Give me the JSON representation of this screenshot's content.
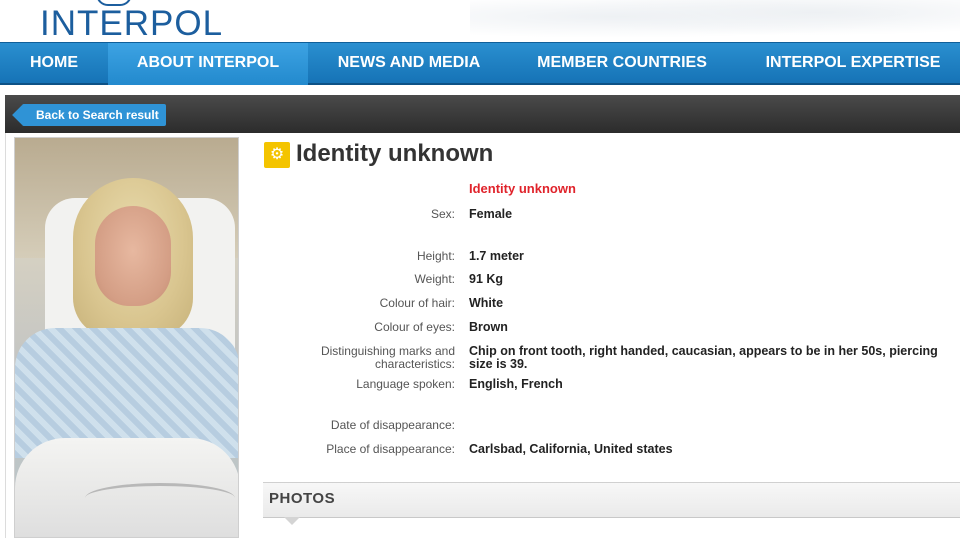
{
  "brand": {
    "logo_text": "INTERPOL",
    "color": "#1c5e9e"
  },
  "nav": {
    "items": [
      {
        "label": "HOME"
      },
      {
        "label": "ABOUT INTERPOL"
      },
      {
        "label": "NEWS AND MEDIA"
      },
      {
        "label": "MEMBER COUNTRIES"
      },
      {
        "label": "INTERPOL EXPERTISE"
      }
    ],
    "active": "ABOUT INTERPOL"
  },
  "back_button": {
    "label": "Back to Search result"
  },
  "notice": {
    "icon": "yellow-notice-icon",
    "title": "Identity unknown",
    "status": "Identity unknown",
    "status_color": "#e0232b",
    "fields": {
      "sex": {
        "label": "Sex:",
        "value": "Female"
      },
      "height": {
        "label": "Height:",
        "value": "1.7 meter"
      },
      "weight": {
        "label": "Weight:",
        "value": "91 Kg"
      },
      "hair": {
        "label": "Colour of hair:",
        "value": "White"
      },
      "eyes": {
        "label": "Colour of eyes:",
        "value": "Brown"
      },
      "marks": {
        "label_line1": "Distinguishing marks and",
        "label_line2": "characteristics:",
        "value": "Chip on front tooth, right handed, caucasian, appears to be in her 50s, piercing",
        "value_line2": "size is 39."
      },
      "language": {
        "label": "Language spoken:",
        "value": "English, French"
      },
      "date_disappearance": {
        "label": "Date of disappearance:",
        "value": ""
      },
      "place_disappearance": {
        "label": "Place of disappearance:",
        "value": "Carlsbad, California, United states"
      }
    }
  },
  "photos_section": {
    "label": "PHOTOS"
  }
}
